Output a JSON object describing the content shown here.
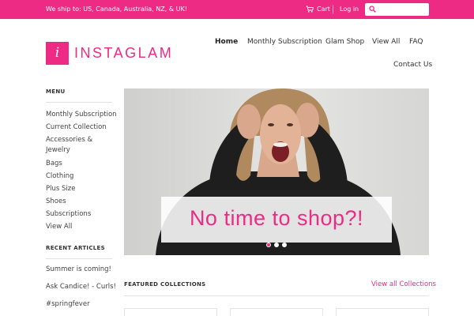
{
  "topbar": {
    "shipping": "We ship to: US, Canada, Australia, NZ, & UK!",
    "cart": "Cart",
    "login": "Log in",
    "search_placeholder": ""
  },
  "logo": {
    "glyph": "i",
    "wordmark": "INSTAGLAM"
  },
  "nav": {
    "items": [
      "Home",
      "Monthly Subscription",
      "Glam Shop",
      "View All",
      "FAQ",
      "Contact Us"
    ],
    "active": "Home"
  },
  "sidebar": {
    "menu_heading": "MENU",
    "menu": [
      "Monthly Subscription",
      "Current Collection",
      "Accessories & Jewelry",
      "Bags",
      "Clothing",
      "Plus Size",
      "Shoes",
      "Subscriptions",
      "View All"
    ],
    "articles_heading": "RECENT ARTICLES",
    "articles": [
      "Summer is coming!",
      "Ask Candice! - Curls!",
      "#springfever"
    ]
  },
  "hero": {
    "caption": "No time to shop?!",
    "slides": 3,
    "active_slide": 1
  },
  "featured": {
    "heading": "FEATURED COLLECTIONS",
    "link": "View all Collections"
  },
  "colors": {
    "brand": "#ee2b84"
  },
  "icons": [
    "cart-icon",
    "search-icon"
  ]
}
